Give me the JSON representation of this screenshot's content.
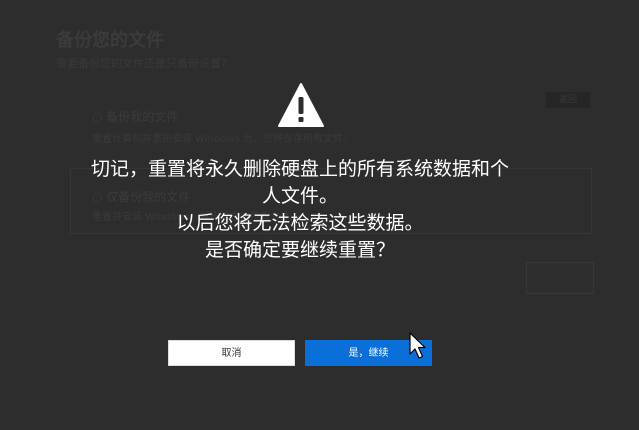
{
  "background": {
    "title": "备份您的文件",
    "subtitle": "需要备份您的文件还是只备份设置?",
    "option1_title": "○ 备份我的文件",
    "option1_desc": "重置计算机并重新安装 Windows 后，您将保存所有文件。",
    "option2_title": "○ 仅备份我的文件",
    "option2_desc": "重置并安装 Windows，并删除您的所有文件。",
    "chip_label": "返回"
  },
  "dialog": {
    "icon": "warning-triangle-icon",
    "message_lines": [
      "切记，重置将永久删除硬盘上的所有系统数据和个",
      "人文件。",
      "以后您将无法检索这些数据。",
      "是否确定要继续重置？"
    ],
    "cancel_label": "取消",
    "continue_label": "是，继续"
  },
  "colors": {
    "background": "#2d2d2d",
    "primary_button": "#0a6fd8",
    "text": "#ffffff"
  }
}
